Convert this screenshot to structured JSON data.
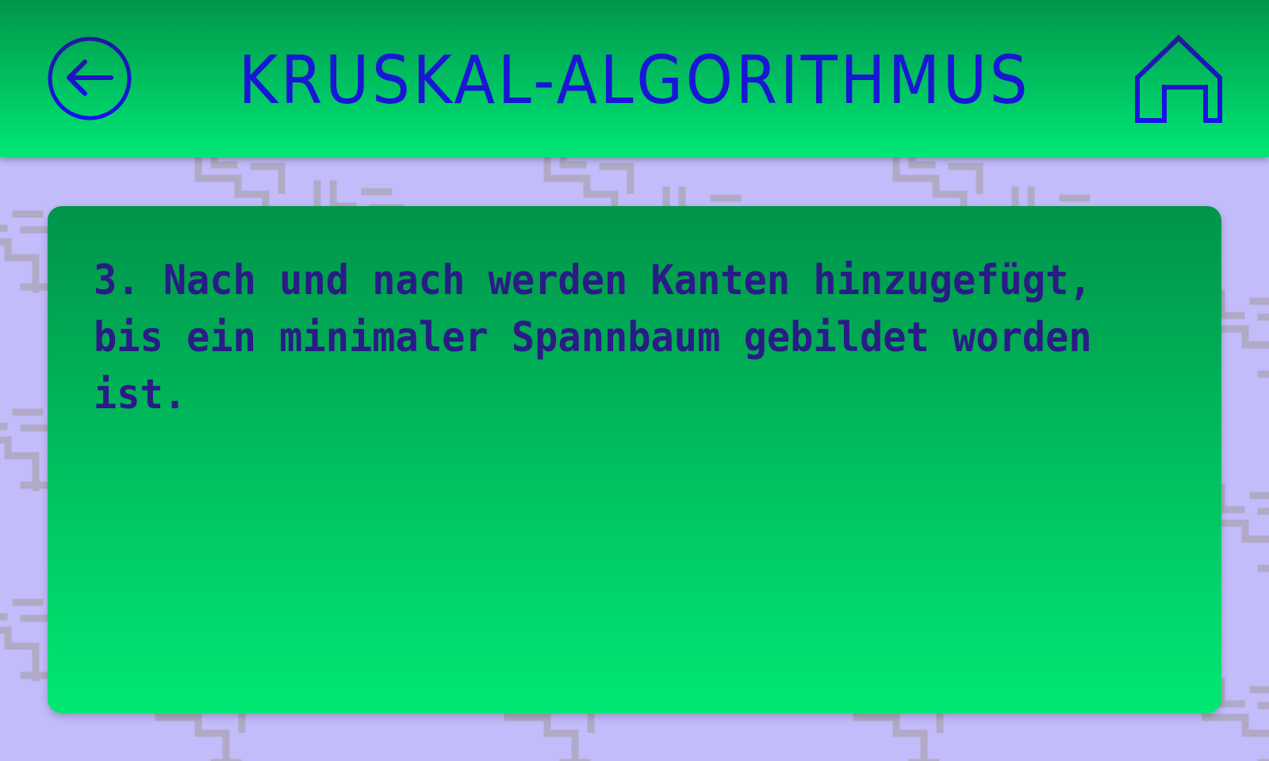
{
  "header": {
    "title": "KRUSKAL-ALGORITHMUS",
    "back_icon": "arrow-left-circle-icon",
    "home_icon": "home-icon"
  },
  "content": {
    "step_text": "3. Nach und nach werden Kanten hinzugefügt, bis ein minimaler Spannbaum gebildet worden ist."
  },
  "colors": {
    "background": "#c2bcfb",
    "pattern": "#b0aac6",
    "header_gradient_top": "#00964a",
    "header_gradient_bottom": "#00e774",
    "card_gradient_top": "#00944a",
    "card_gradient_bottom": "#00e874",
    "title_color": "#1a16d6",
    "icon_color": "#1a16d6",
    "text_color": "#2a1b86"
  }
}
